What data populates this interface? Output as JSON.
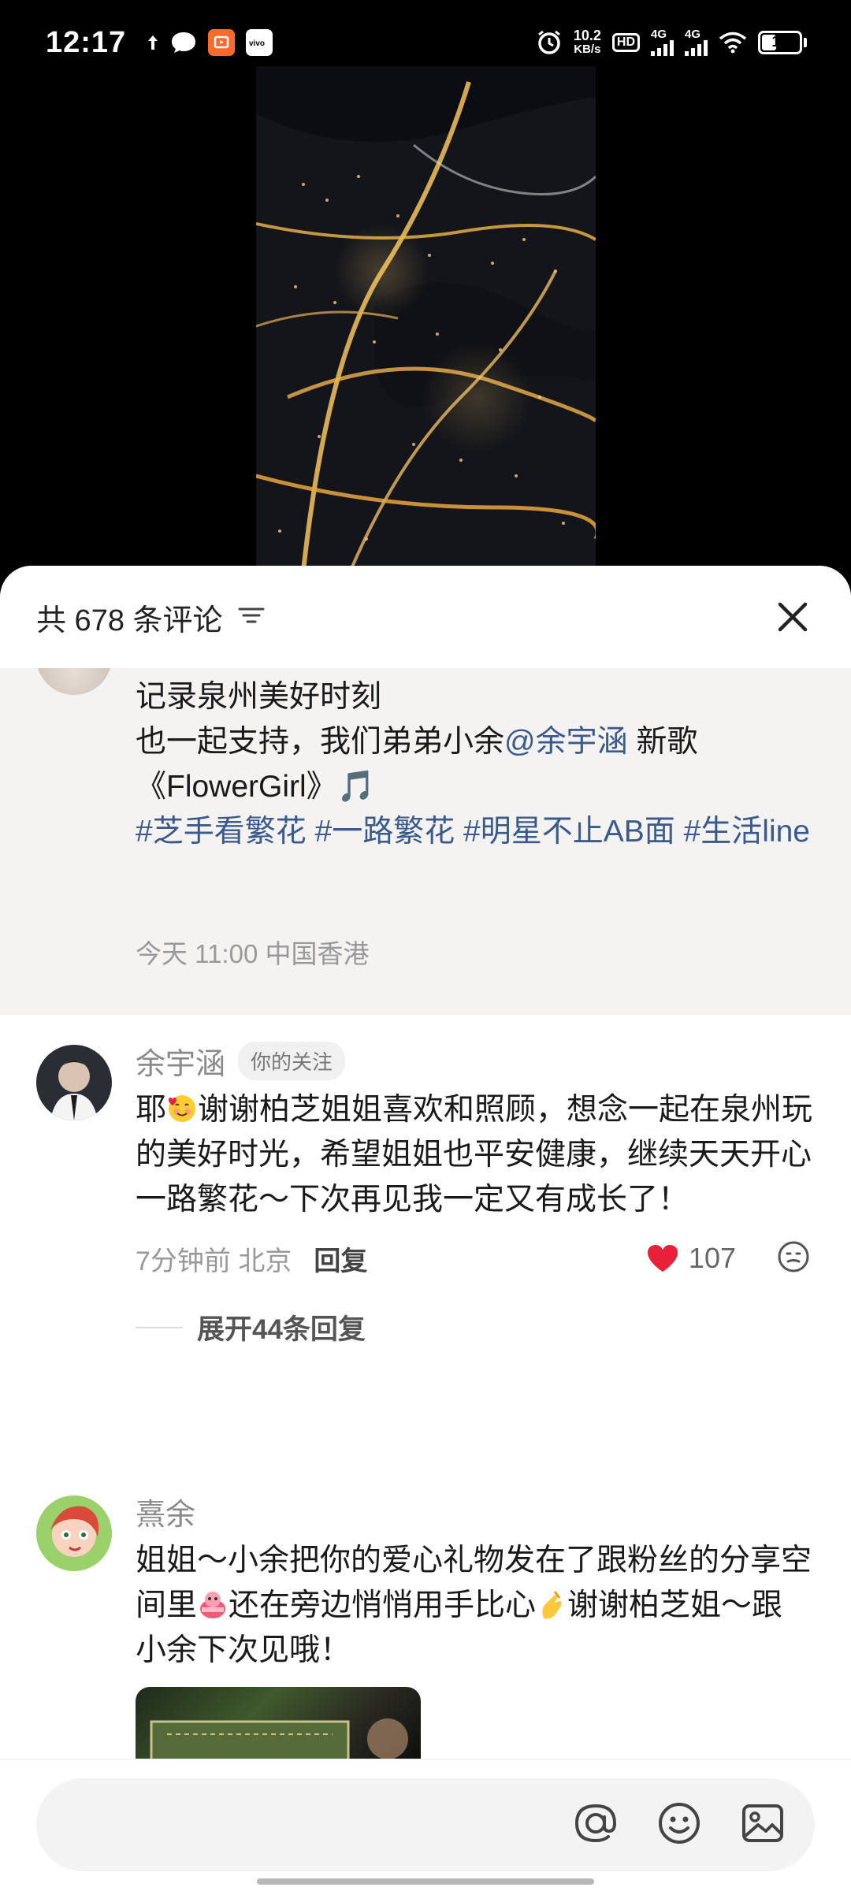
{
  "status_bar": {
    "time": "12:17",
    "net_speed_value": "10.2",
    "net_speed_unit": "KB/s",
    "hd_label": "HD",
    "signal1_label": "4G",
    "signal2_label": "4G",
    "battery_level": "15",
    "icons": [
      "upload-arrow-icon",
      "message-bubble-icon",
      "app-icon",
      "vivo-icon",
      "alarm-icon",
      "wifi-icon",
      "battery-icon"
    ]
  },
  "sheet": {
    "header": {
      "comment_count_label": "共 678 条评论",
      "sort_icon": "filter-lines-icon",
      "close_icon": "close-icon"
    },
    "caption": {
      "line1": "记录泉州美好时刻",
      "line2_prefix": "也一起支持，我们弟弟小余",
      "mention": "@余宇涵",
      "line2_suffix": " 新歌",
      "line3": "《FlowerGirl》🎵",
      "hashtags": "#芝手看繁花 #一路繁花 #明星不止AB面 #生活line",
      "meta": "今天 11:00 中国香港"
    },
    "comments": [
      {
        "username": "余宇涵",
        "badge": "你的关注",
        "text_prefix": "耶",
        "text": "谢谢柏芝姐姐喜欢和照顾，想念一起在泉州玩的美好时光，希望姐姐也平安健康，继续天天开心一路繁花～下次再见我一定又有成长了！",
        "meta": "7分钟前 北京",
        "reply_label": "回复",
        "like_count": "107",
        "liked": true,
        "expand_label": "展开44条回复"
      },
      {
        "username": "熹余",
        "text_part1": "姐姐～小余把你的爱心礼物发在了跟粉丝的分享空间里",
        "text_part2": "还在旁边悄悄用手比心",
        "text_part3": "谢谢柏芝姐～跟小余下次见哦！"
      }
    ]
  },
  "input_bar": {
    "placeholder": "",
    "icons": [
      "at-icon",
      "emoji-icon",
      "image-icon"
    ]
  },
  "colors": {
    "accent_link": "#3a5a8c",
    "like_red": "#e8213a",
    "sheet_bg": "#ffffff",
    "caption_bg": "#f5f2f2"
  }
}
